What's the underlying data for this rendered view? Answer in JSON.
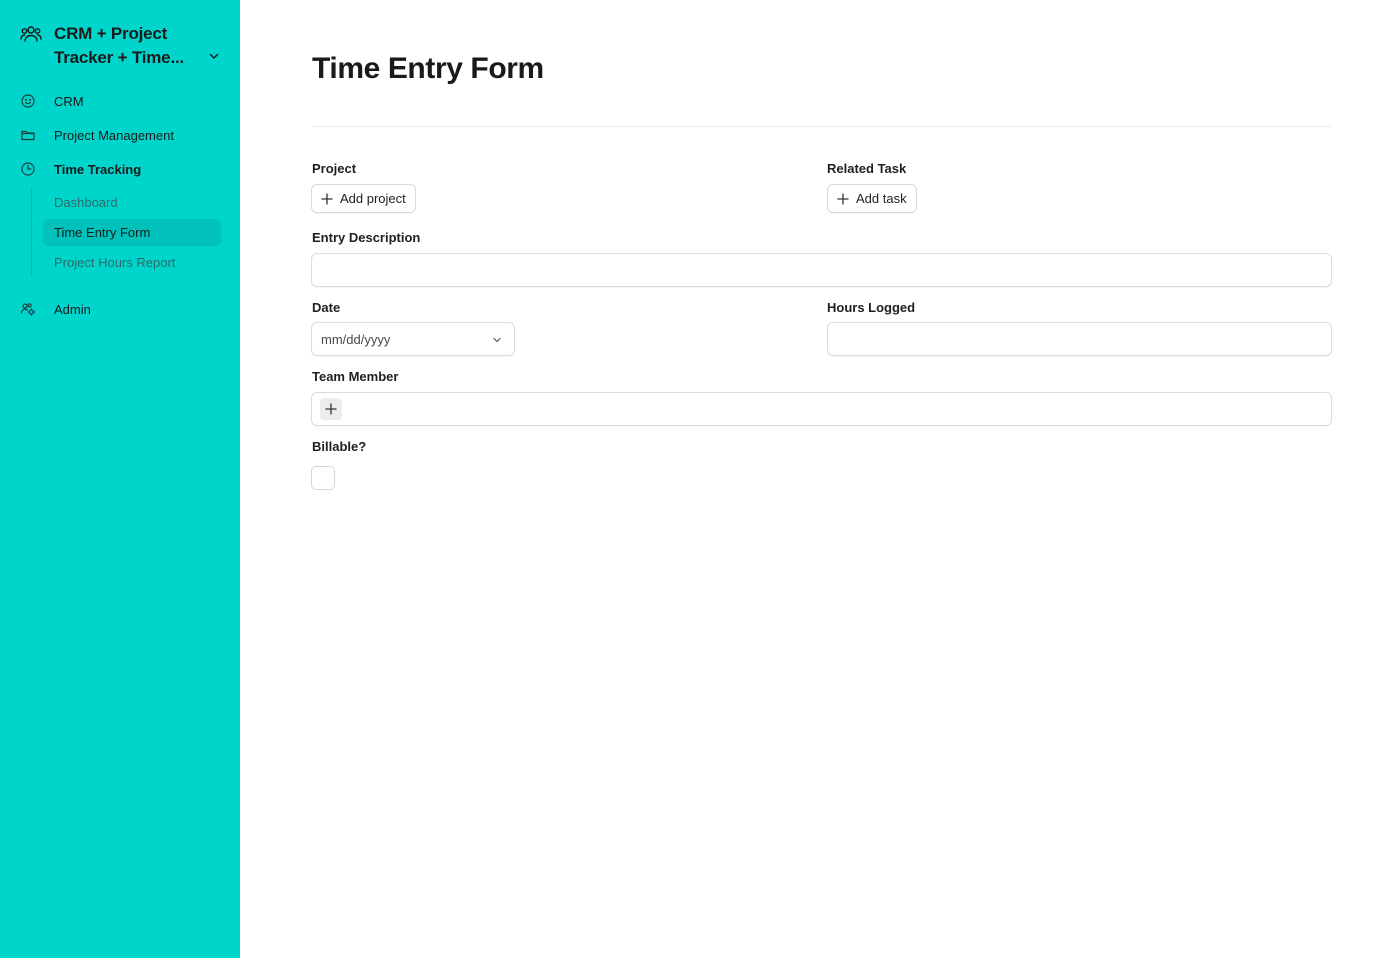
{
  "workspace": {
    "title": "CRM + Project Tracker + Time...",
    "icon": "people-icon"
  },
  "sidebar": {
    "items": [
      {
        "label": "CRM",
        "icon": "smiley-icon"
      },
      {
        "label": "Project Management",
        "icon": "folder-icon"
      },
      {
        "label": "Time Tracking",
        "icon": "clock-icon"
      },
      {
        "label": "Admin",
        "icon": "users-gear-icon"
      }
    ],
    "sub_items": [
      {
        "label": "Dashboard"
      },
      {
        "label": "Time Entry Form",
        "active": true
      },
      {
        "label": "Project Hours Report"
      }
    ]
  },
  "page": {
    "title": "Time Entry Form"
  },
  "form": {
    "project": {
      "label": "Project",
      "button": "Add project"
    },
    "related_task": {
      "label": "Related Task",
      "button": "Add task"
    },
    "entry_description": {
      "label": "Entry Description",
      "value": ""
    },
    "date": {
      "label": "Date",
      "placeholder": "mm/dd/yyyy"
    },
    "hours_logged": {
      "label": "Hours Logged",
      "value": ""
    },
    "team_member": {
      "label": "Team Member"
    },
    "billable": {
      "label": "Billable?",
      "checked": false
    }
  },
  "colors": {
    "sidebar_bg": "#00d5cc",
    "active_item_bg": "#00c2ba"
  }
}
